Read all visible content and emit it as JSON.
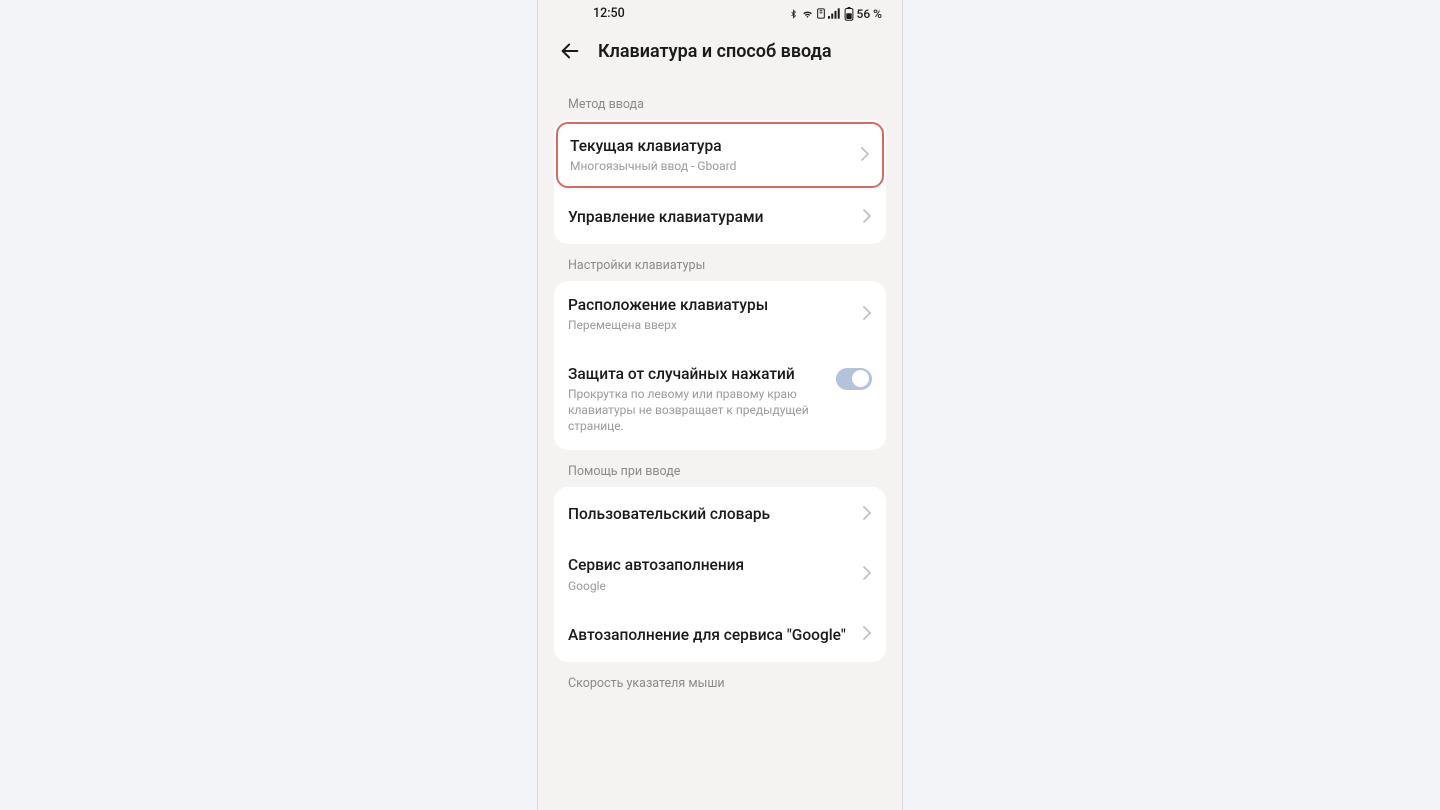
{
  "status": {
    "time": "12:50",
    "battery": "56 %"
  },
  "header": {
    "title": "Клавиатура и способ ввода"
  },
  "sections": [
    {
      "label": "Метод ввода",
      "rows": [
        {
          "title": "Текущая клавиатура",
          "subtitle": "Многоязычный ввод - Gboard"
        },
        {
          "title": "Управление клавиатурами"
        }
      ]
    },
    {
      "label": "Настройки клавиатуры",
      "rows": [
        {
          "title": "Расположение клавиатуры",
          "subtitle": "Перемещена вверх"
        },
        {
          "title": "Защита от случайных нажатий",
          "subtitle": "Прокрутка по левому или правому краю клавиатуры не возвращает к предыдущей странице."
        }
      ]
    },
    {
      "label": "Помощь при вводе",
      "rows": [
        {
          "title": "Пользовательский словарь"
        },
        {
          "title": "Сервис автозаполнения",
          "subtitle": "Google"
        },
        {
          "title": "Автозаполнение для сервиса \"Google\""
        }
      ]
    },
    {
      "label": "Скорость указателя мыши"
    }
  ]
}
